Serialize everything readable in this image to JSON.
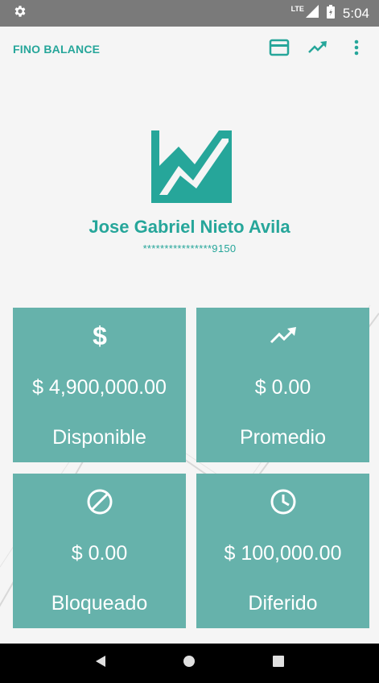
{
  "status_bar": {
    "network": "LTE",
    "time": "5:04"
  },
  "app_bar": {
    "title": "FINO BALANCE",
    "actions": [
      "card-icon",
      "trending-up-icon",
      "more-vert-icon"
    ]
  },
  "profile": {
    "name": "Jose Gabriel Nieto Avila",
    "card_number": "****************9150"
  },
  "tiles": [
    {
      "icon": "dollar-icon",
      "amount": "$ 4,900,000.00",
      "label": "Disponible"
    },
    {
      "icon": "trending-up-icon",
      "amount": "$ 0.00",
      "label": "Promedio"
    },
    {
      "icon": "block-icon",
      "amount": "$ 0.00",
      "label": "Bloqueado"
    },
    {
      "icon": "clock-icon",
      "amount": "$ 100,000.00",
      "label": "Diferido"
    }
  ],
  "colors": {
    "accent": "#26a69a",
    "tile": "#66b2ab",
    "status_bar": "#7a7a7a",
    "nav_bar": "#000000"
  }
}
